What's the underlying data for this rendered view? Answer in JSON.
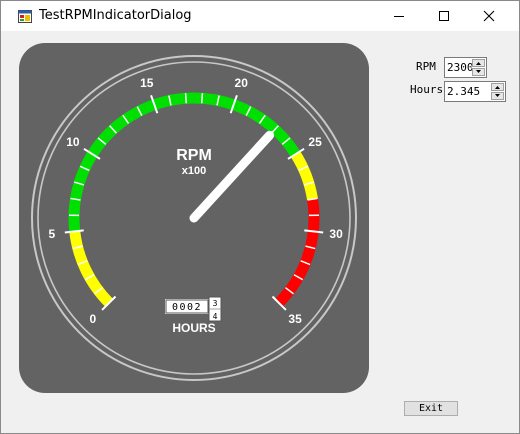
{
  "window": {
    "title": "TestRPMIndicatorDialog"
  },
  "gauge": {
    "label": "RPM",
    "multiplier": "x100",
    "min": 0,
    "max": 35,
    "value": 23,
    "tick_labels": [
      "0",
      "5",
      "10",
      "15",
      "20",
      "25",
      "30",
      "35"
    ],
    "bands": [
      {
        "from": 0,
        "to": 5,
        "color": "#ffff00"
      },
      {
        "from": 5,
        "to": 25,
        "color": "#00e000"
      },
      {
        "from": 25,
        "to": 28,
        "color": "#ffff00"
      },
      {
        "from": 28,
        "to": 35,
        "color": "#ff0000"
      }
    ],
    "hours_label": "HOURS",
    "odometer_digits": "0002",
    "odometer_fraction_top": "3",
    "odometer_fraction_bottom": "4",
    "colors": {
      "face": "#636363",
      "ring": "#c8c8c8",
      "needle": "#ffffff"
    }
  },
  "controls": {
    "rpm_label": "RPM",
    "rpm_value": "2300",
    "hours_label": "Hours",
    "hours_value": "2.345"
  },
  "buttons": {
    "exit": "Exit"
  }
}
